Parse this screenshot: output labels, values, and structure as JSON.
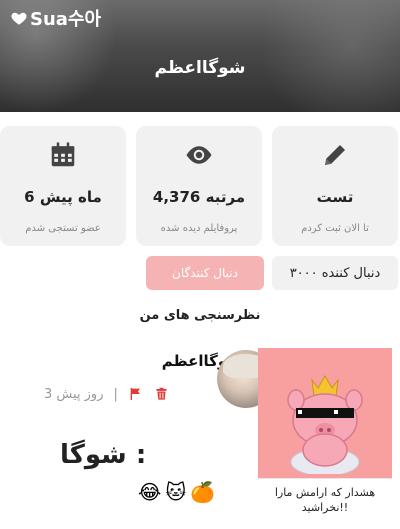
{
  "header": {
    "logo_text": "Sua수아",
    "logo_icon": "heart-icon",
    "title": "شوگااعظم"
  },
  "stats": [
    {
      "icon": "calendar-icon",
      "value": "6 ماه پیش",
      "label": "عضو تستجی شدم"
    },
    {
      "icon": "eye-icon",
      "value": "4,376 مرتبه",
      "label": "پروفایلم دیده شده"
    },
    {
      "icon": "pencil-icon",
      "value": "تست",
      "label": "تا الان ثبت کردم"
    }
  ],
  "follow": {
    "button_label": "دنبال کنندگان",
    "followers_label": "۳۰۰۰ دنبال کننده"
  },
  "section_title": "نظرسنجی های من",
  "post": {
    "author": "شوگااعظم",
    "time": "3 روز پیش",
    "divider": "|",
    "delete_icon": "trash-icon",
    "report_icon": "flag-icon",
    "text": "شوگا :",
    "emojis": [
      "🍊",
      "🐱",
      "😂"
    ],
    "sticker_caption": "هشدار که ارامش مارا نخراشید!!"
  },
  "colors": {
    "accent": "#e53935",
    "follow_button": "#f6b3b3",
    "card_bg": "#f1f1f1",
    "sticker_bg": "#f8a0a0"
  }
}
